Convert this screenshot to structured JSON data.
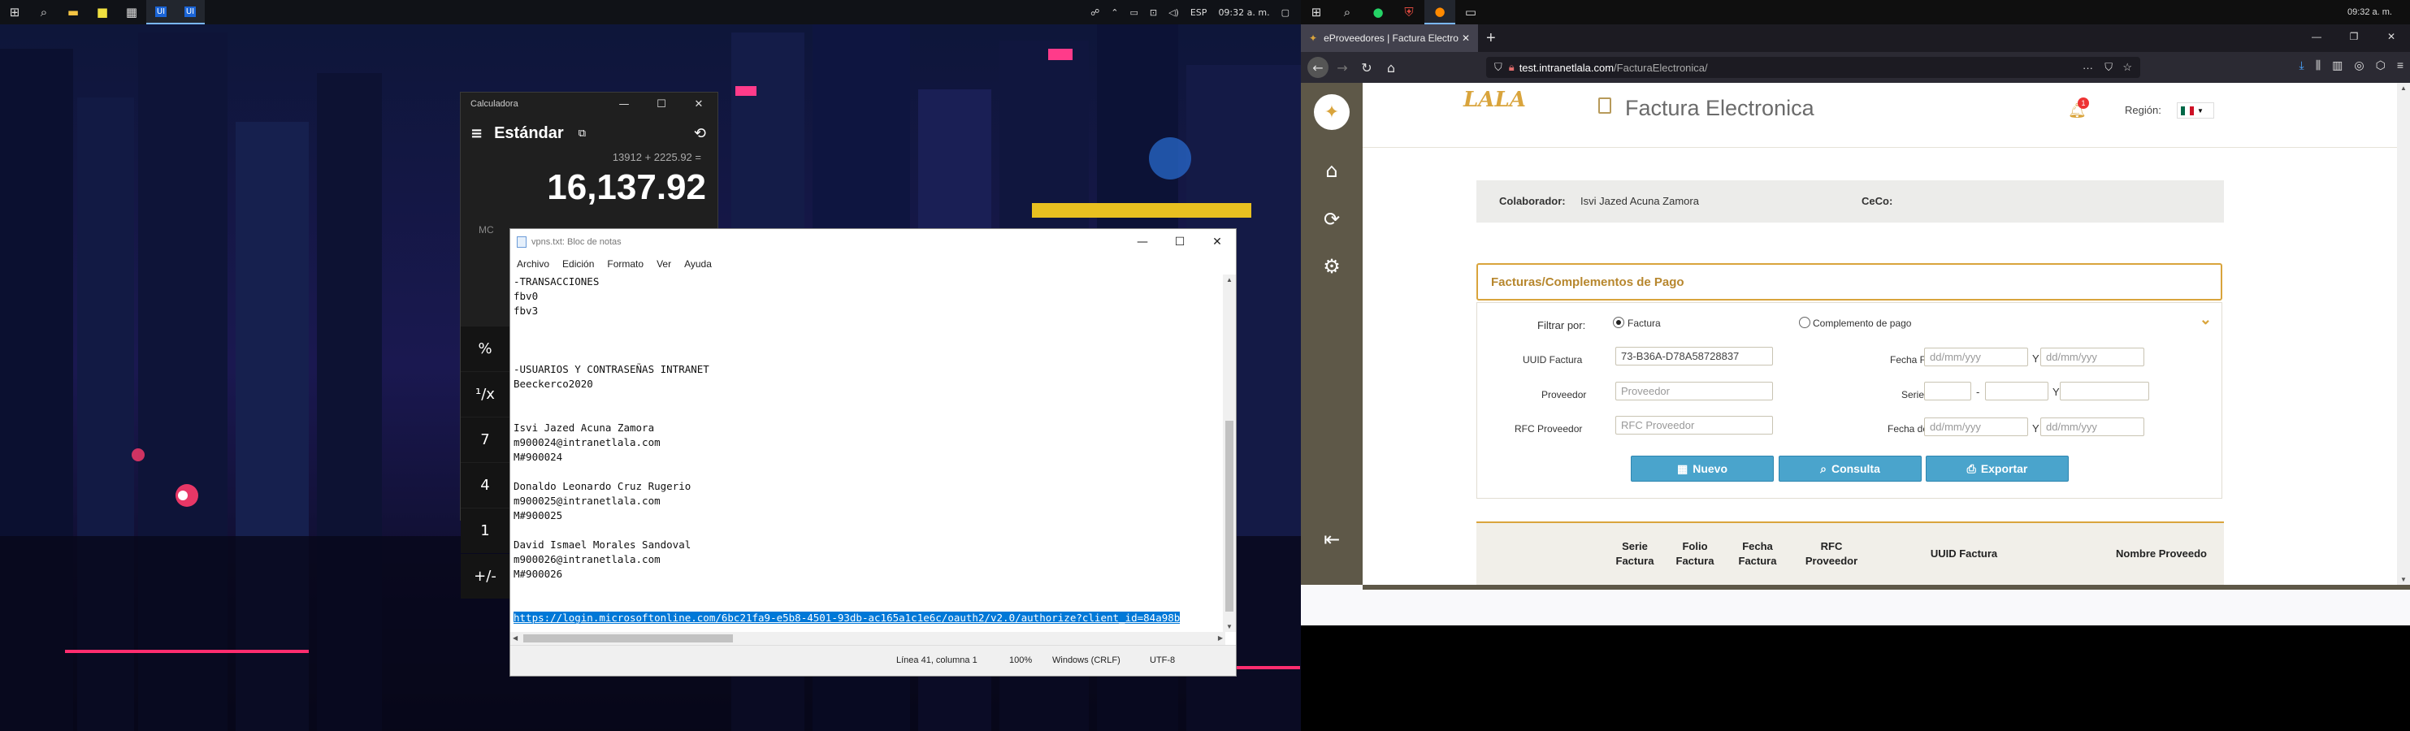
{
  "left_taskbar": {
    "icons": [
      "windows-icon",
      "search-icon",
      "file-explorer-icon",
      "sticky-notes-icon",
      "calculator-icon",
      "ui-icon",
      "ui-icon"
    ],
    "lang": "ESP",
    "time": "09:32 a. m."
  },
  "calculator": {
    "window_title": "Calculadora",
    "mode": "Estándar",
    "expression": "13912 + 2225.92 =",
    "result": "16,137.92",
    "memory": "MC",
    "keys": [
      "%",
      "¹/x",
      "7",
      "4",
      "1",
      "+/-"
    ]
  },
  "notepad": {
    "window_title": "vpns.txt: Bloc de notas",
    "menu": [
      "Archivo",
      "Edición",
      "Formato",
      "Ver",
      "Ayuda"
    ],
    "lines": [
      "-TRANSACCIONES",
      "fbv0",
      "fbv3",
      "",
      "",
      "",
      "-USUARIOS Y CONTRASEÑAS INTRANET",
      "Beeckerco2020",
      "",
      "",
      "Isvi Jazed Acuna Zamora",
      "m900024@intranetlala.com",
      "M#900024",
      "",
      "Donaldo Leonardo Cruz Rugerio",
      "m900025@intranetlala.com",
      "M#900025",
      "",
      "David Ismael Morales Sandoval",
      "m900026@intranetlala.com",
      "M#900026",
      "",
      ""
    ],
    "selected_line": "https://login.microsoftonline.com/6bc21fa9-e5b8-4501-93db-ac165a1c1e6c/oauth2/v2.0/authorize?client_id=84a98b",
    "status": {
      "position": "Línea 41, columna 1",
      "zoom": "100%",
      "line_ending": "Windows (CRLF)",
      "encoding": "UTF-8"
    }
  },
  "browser": {
    "time": "09:32 a. m.",
    "tab_title": "eProveedores | Factura Electro",
    "url_host": "test.intranetlala.com",
    "url_path": "/FacturaElectronica/"
  },
  "app": {
    "logo": "LALA",
    "page_title": "Factura Electronica",
    "notification_count": "1",
    "region_label": "Región:",
    "colaborador_label": "Colaborador:",
    "colaborador_value": "Isvi Jazed Acuna Zamora",
    "ceco_label": "CeCo:",
    "panel_title": "Facturas/Complementos de Pago",
    "filter_label": "Filtrar por:",
    "radio_factura": "Factura",
    "radio_complemento": "Complemento de pago",
    "uuid_label": "UUID Factura",
    "uuid_value": "73-B36A-D78A58728837",
    "fecha_factura_label": "Fecha Factura",
    "date_placeholder": "dd/mm/yyy",
    "y_label": "Y",
    "proveedor_label": "Proveedor",
    "proveedor_placeholder": "Proveedor",
    "serie_label": "Serie - Folio",
    "dash": "-",
    "rfc_label": "RFC Proveedor",
    "rfc_placeholder": "RFC Proveedor",
    "fecha_pago_label": "Fecha de pago",
    "btn_nuevo": "Nuevo",
    "btn_consulta": "Consulta",
    "btn_exportar": "Exportar",
    "table_headers": [
      "Serie Factura",
      "Folio Factura",
      "Fecha Factura",
      "RFC Proveedor",
      "UUID Factura",
      "Nombre Proveedo"
    ]
  }
}
